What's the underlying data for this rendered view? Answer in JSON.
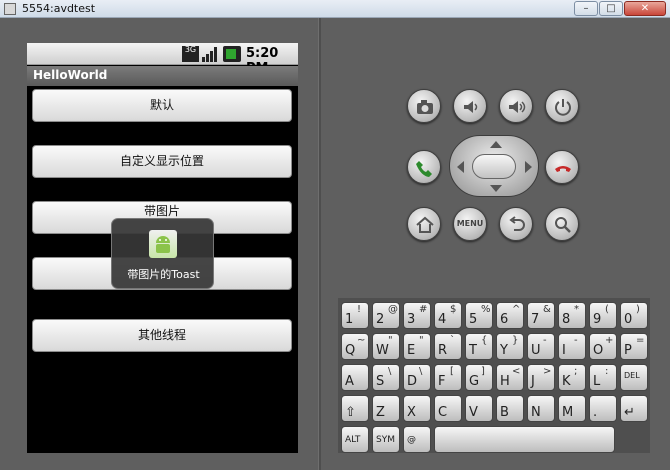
{
  "window": {
    "title": "5554:avdtest",
    "controls": {
      "minimize": "–",
      "maximize": "□",
      "close": "✕"
    }
  },
  "phone": {
    "status_bar": {
      "network": "3G",
      "time": "5:20",
      "time_suffix": "PM"
    },
    "app_title": "HelloWorld",
    "buttons": [
      {
        "label": "默认"
      },
      {
        "label": "自定义显示位置"
      },
      {
        "label": "带图片"
      },
      {
        "label": ""
      },
      {
        "label": "其他线程"
      }
    ],
    "toast": {
      "text": "带图片的Toast",
      "icon": "android-app-icon"
    }
  },
  "controls": {
    "top_row": [
      "camera-icon",
      "volume-down-icon",
      "volume-up-icon",
      "power-icon"
    ],
    "call_button": "call-icon",
    "end_call_button": "end-call-icon",
    "bottom_row": [
      "home-icon",
      "menu-button",
      "back-icon",
      "search-icon"
    ],
    "menu_label": "MENU"
  },
  "keyboard": {
    "row1": [
      {
        "main": "1",
        "sym": "!"
      },
      {
        "main": "2",
        "sym": "@"
      },
      {
        "main": "3",
        "sym": "#"
      },
      {
        "main": "4",
        "sym": "$"
      },
      {
        "main": "5",
        "sym": "%"
      },
      {
        "main": "6",
        "sym": "^"
      },
      {
        "main": "7",
        "sym": "&"
      },
      {
        "main": "8",
        "sym": "*"
      },
      {
        "main": "9",
        "sym": "("
      },
      {
        "main": "0",
        "sym": ")"
      }
    ],
    "row2": [
      {
        "main": "Q",
        "sym": "~"
      },
      {
        "main": "W",
        "sym": "\""
      },
      {
        "main": "E",
        "sym": "\""
      },
      {
        "main": "R",
        "sym": "`"
      },
      {
        "main": "T",
        "sym": "{"
      },
      {
        "main": "Y",
        "sym": "}"
      },
      {
        "main": "U",
        "sym": "-"
      },
      {
        "main": "I",
        "sym": "-"
      },
      {
        "main": "O",
        "sym": "+"
      },
      {
        "main": "P",
        "sym": "="
      }
    ],
    "row3": [
      {
        "main": "A",
        "sym": ""
      },
      {
        "main": "S",
        "sym": "\\"
      },
      {
        "main": "D",
        "sym": "\\"
      },
      {
        "main": "F",
        "sym": "["
      },
      {
        "main": "G",
        "sym": "]"
      },
      {
        "main": "H",
        "sym": "<"
      },
      {
        "main": "J",
        "sym": ">"
      },
      {
        "main": "K",
        "sym": ";"
      },
      {
        "main": "L",
        "sym": ":"
      },
      {
        "main": "DEL",
        "sym": ""
      }
    ],
    "row4": [
      {
        "main": "⇧",
        "sym": ""
      },
      {
        "main": "Z",
        "sym": ""
      },
      {
        "main": "X",
        "sym": ""
      },
      {
        "main": "C",
        "sym": ""
      },
      {
        "main": "V",
        "sym": ""
      },
      {
        "main": "B",
        "sym": ""
      },
      {
        "main": "N",
        "sym": ""
      },
      {
        "main": "M",
        "sym": ""
      },
      {
        "main": ".",
        "sym": ""
      },
      {
        "main": "↵",
        "sym": ""
      }
    ],
    "row5": [
      {
        "main": "ALT",
        "sym": ""
      },
      {
        "main": "SYM",
        "sym": ""
      },
      {
        "main": "@",
        "sym": ""
      },
      {
        "main": "",
        "sym": ""
      }
    ]
  }
}
